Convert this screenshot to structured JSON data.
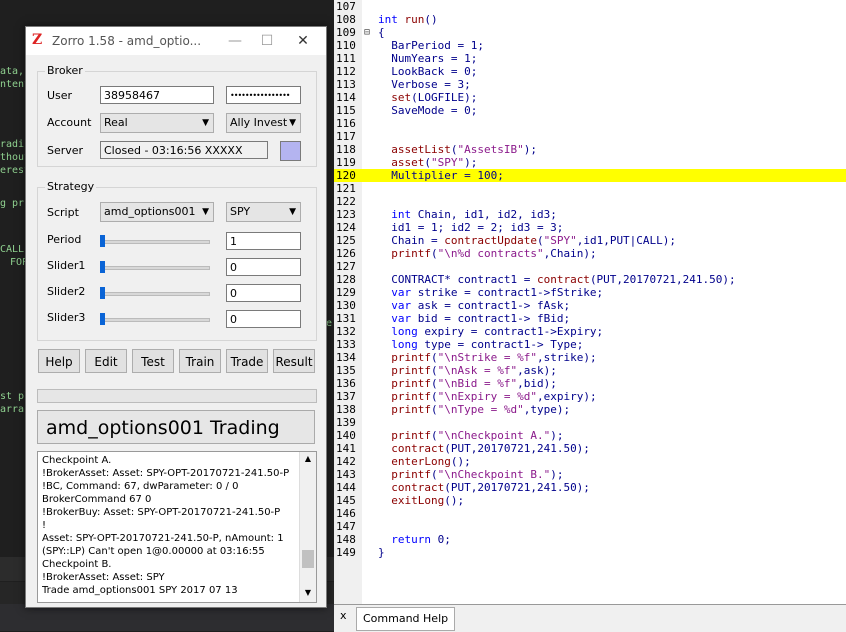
{
  "background": {
    "fragments": [
      "ata,",
      "ntent",
      "radi",
      "thout",
      "erest",
      "g pr",
      "CALL",
      "FOP",
      "e",
      "st pl",
      "arra"
    ]
  },
  "dialog": {
    "title": "Zorro 1.58 - amd_optio...",
    "broker_group": "Broker",
    "user_label": "User",
    "user_value": "38958467",
    "password_value": "••••••••••••••••",
    "account_label": "Account",
    "account_value": "Real",
    "broker_value": "Ally Invest",
    "server_label": "Server",
    "server_value": "Closed - 03:16:56  XXXXX",
    "strategy_group": "Strategy",
    "script_label": "Script",
    "script_value": "amd_options001",
    "asset_value": "SPY",
    "period_label": "Period",
    "period_value": "1",
    "slider1_label": "Slider1",
    "slider1_value": "0",
    "slider2_label": "Slider2",
    "slider2_value": "0",
    "slider3_label": "Slider3",
    "slider3_value": "0",
    "buttons": [
      "Help",
      "Edit",
      "Test",
      "Train",
      "Trade",
      "Result"
    ],
    "status_text": "amd_options001 Trading",
    "log": [
      "Checkpoint A.",
      "!BrokerAsset: Asset: SPY-OPT-20170721-241.50-P",
      "!BC, Command: 67, dwParameter: 0 / 0",
      "BrokerCommand 67 0",
      "!BrokerBuy: Asset: SPY-OPT-20170721-241.50-P",
      "!",
      "Asset: SPY-OPT-20170721-241.50-P, nAmount: 1",
      "(SPY::LP) Can't open 1@0.00000 at 03:16:55",
      "Checkpoint B.",
      "!BrokerAsset: Asset: SPY",
      "",
      "Trade  amd_options001 SPY 2017 07 13"
    ]
  },
  "editor": {
    "highlight_color": "#ffff00",
    "lines": [
      {
        "n": "107",
        "text": ""
      },
      {
        "n": "108",
        "text": "int run()"
      },
      {
        "n": "109",
        "text": "{"
      },
      {
        "n": "110",
        "text": "  BarPeriod = 1;"
      },
      {
        "n": "111",
        "text": "  NumYears = 1;"
      },
      {
        "n": "112",
        "text": "  LookBack = 0;"
      },
      {
        "n": "113",
        "text": "  Verbose = 3;"
      },
      {
        "n": "114",
        "text": "  set(LOGFILE);"
      },
      {
        "n": "115",
        "text": "  SaveMode = 0;"
      },
      {
        "n": "116",
        "text": ""
      },
      {
        "n": "117",
        "text": ""
      },
      {
        "n": "118",
        "text": "  assetList(\"AssetsIB\");"
      },
      {
        "n": "119",
        "text": "  asset(\"SPY\");"
      },
      {
        "n": "120",
        "text": "  Multiplier = 100;"
      },
      {
        "n": "121",
        "text": ""
      },
      {
        "n": "122",
        "text": ""
      },
      {
        "n": "123",
        "text": "  int Chain, id1, id2, id3;"
      },
      {
        "n": "124",
        "text": "  id1 = 1; id2 = 2; id3 = 3;"
      },
      {
        "n": "125",
        "text": "  Chain = contractUpdate(\"SPY\",id1,PUT|CALL);"
      },
      {
        "n": "126",
        "text": "  printf(\"\\n%d contracts\",Chain);"
      },
      {
        "n": "127",
        "text": ""
      },
      {
        "n": "128",
        "text": "  CONTRACT* contract1 = contract(PUT,20170721,241.50);"
      },
      {
        "n": "129",
        "text": "  var strike = contract1->fStrike;"
      },
      {
        "n": "130",
        "text": "  var ask = contract1-> fAsk;"
      },
      {
        "n": "131",
        "text": "  var bid = contract1-> fBid;"
      },
      {
        "n": "132",
        "text": "  long expiry = contract1->Expiry;"
      },
      {
        "n": "133",
        "text": "  long type = contract1-> Type;"
      },
      {
        "n": "134",
        "text": "  printf(\"\\nStrike = %f\",strike);"
      },
      {
        "n": "135",
        "text": "  printf(\"\\nAsk = %f\",ask);"
      },
      {
        "n": "136",
        "text": "  printf(\"\\nBid = %f\",bid);"
      },
      {
        "n": "137",
        "text": "  printf(\"\\nExpiry = %d\",expiry);"
      },
      {
        "n": "138",
        "text": "  printf(\"\\nType = %d\",type);"
      },
      {
        "n": "139",
        "text": ""
      },
      {
        "n": "140",
        "text": "  printf(\"\\nCheckpoint A.\");"
      },
      {
        "n": "141",
        "text": "  contract(PUT,20170721,241.50);"
      },
      {
        "n": "142",
        "text": "  enterLong();"
      },
      {
        "n": "143",
        "text": "  printf(\"\\nCheckpoint B.\");"
      },
      {
        "n": "144",
        "text": "  contract(PUT,20170721,241.50);"
      },
      {
        "n": "145",
        "text": "  exitLong();"
      },
      {
        "n": "146",
        "text": ""
      },
      {
        "n": "147",
        "text": ""
      },
      {
        "n": "148",
        "text": "  return 0;"
      },
      {
        "n": "149",
        "text": "}"
      }
    ]
  },
  "bottom": {
    "close_glyph": "x",
    "tab_label": "Command Help"
  }
}
